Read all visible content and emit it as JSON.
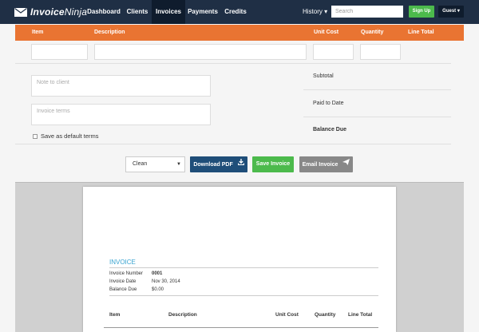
{
  "brand": {
    "name_bold": "Invoice",
    "name_thin": "Ninja"
  },
  "nav": {
    "items": [
      {
        "label": "Dashboard"
      },
      {
        "label": "Clients"
      },
      {
        "label": "Invoices",
        "active": true
      },
      {
        "label": "Payments"
      },
      {
        "label": "Credits"
      }
    ],
    "history_label": "History ▾",
    "search_placeholder": "Search",
    "signup_label": "Sign Up",
    "guest_label": "Guest ▾"
  },
  "table": {
    "headers": {
      "item": "Item",
      "description": "Description",
      "unit_cost": "Unit Cost",
      "quantity": "Quantity",
      "line_total": "Line Total"
    }
  },
  "form": {
    "note_placeholder": "Note to client",
    "terms_placeholder": "Invoice terms",
    "save_default_label": "Save as default terms"
  },
  "totals": {
    "subtotal": "Subtotal",
    "paid_to_date": "Paid to Date",
    "balance_due": "Balance Due"
  },
  "actions": {
    "template_selected": "Clean",
    "download_label": "Download PDF",
    "save_label": "Save Invoice",
    "email_label": "Email Invoice"
  },
  "preview": {
    "title": "INVOICE",
    "fields": [
      {
        "label": "Invoice Number",
        "value": "0001"
      },
      {
        "label": "Invoice Date",
        "value": "Nov 30, 2014"
      },
      {
        "label": "Balance Due",
        "value": "$0.00"
      }
    ],
    "columns": {
      "item": "Item",
      "description": "Description",
      "unit_cost": "Unit Cost",
      "quantity": "Quantity",
      "line_total": "Line Total"
    }
  },
  "colors": {
    "navbar": "#1f2f45",
    "header_orange": "#e97432",
    "accent_green": "#4cba4c",
    "download_blue": "#1f4e79",
    "invoice_title": "#37a3d0"
  },
  "icons": [
    "envelope-logo-icon",
    "download-icon",
    "send-icon",
    "chevron-down-icon"
  ]
}
